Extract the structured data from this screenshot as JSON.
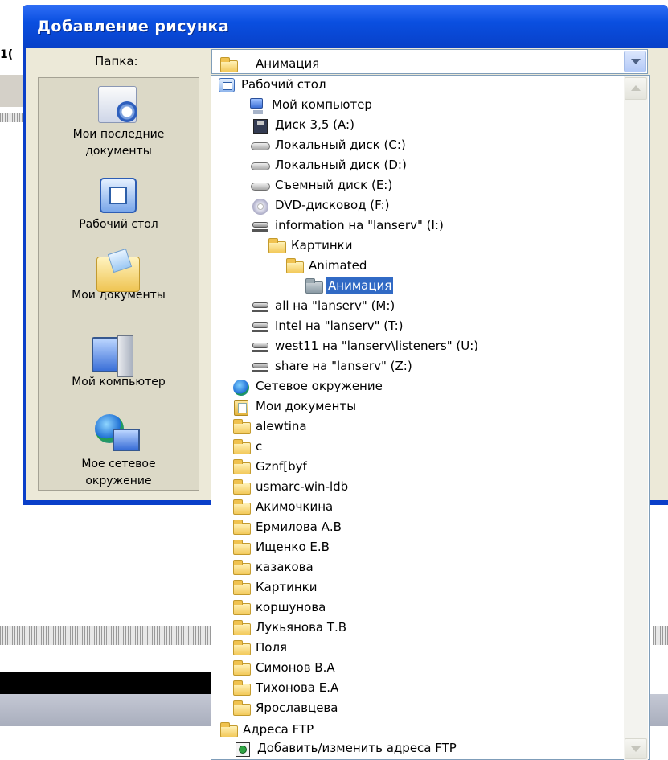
{
  "background": {
    "fragment_number": "1("
  },
  "dialog": {
    "title": "Добавление рисунка",
    "folder_label": "Папка:",
    "folder_value": "Анимация"
  },
  "places": [
    {
      "label": "Мои последние документы",
      "icon": "recent-documents-icon"
    },
    {
      "label": "Рабочий стол",
      "icon": "desktop-icon"
    },
    {
      "label": "Мои документы",
      "icon": "my-documents-icon"
    },
    {
      "label": "Мой компьютер",
      "icon": "my-computer-icon"
    },
    {
      "label": "Мое сетевое окружение",
      "icon": "network-places-icon"
    }
  ],
  "dropdown": {
    "selected": "Анимация",
    "items": [
      {
        "label": "Рабочий стол",
        "icon": "desktop-icon"
      },
      {
        "label": "Мой компьютер",
        "icon": "computer-icon"
      },
      {
        "label": "Диск 3,5 (A:)",
        "icon": "floppy-icon"
      },
      {
        "label": "Локальный диск (C:)",
        "icon": "hard-drive-icon"
      },
      {
        "label": "Локальный диск (D:)",
        "icon": "hard-drive-icon"
      },
      {
        "label": "Съемный диск (E:)",
        "icon": "removable-drive-icon"
      },
      {
        "label": "DVD-дисковод (F:)",
        "icon": "dvd-drive-icon"
      },
      {
        "label": "information на \"lanserv\" (I:)",
        "icon": "network-drive-icon"
      },
      {
        "label": "Картинки",
        "icon": "folder-icon"
      },
      {
        "label": "Animated",
        "icon": "folder-icon"
      },
      {
        "label": "Анимация",
        "icon": "folder-open-icon"
      },
      {
        "label": "all на \"lanserv\" (M:)",
        "icon": "network-drive-icon"
      },
      {
        "label": "Intel на \"lanserv\" (T:)",
        "icon": "network-drive-icon"
      },
      {
        "label": "west11 на \"lanserv\\listeners\" (U:)",
        "icon": "network-drive-icon"
      },
      {
        "label": "share на \"lanserv\" (Z:)",
        "icon": "network-drive-icon"
      },
      {
        "label": "Сетевое окружение",
        "icon": "network-places-icon"
      },
      {
        "label": "Мои документы",
        "icon": "my-documents-icon"
      },
      {
        "label": "alewtina",
        "icon": "folder-icon"
      },
      {
        "label": "c",
        "icon": "folder-icon"
      },
      {
        "label": "Gznf[byf",
        "icon": "folder-icon"
      },
      {
        "label": "usmarc-win-ldb",
        "icon": "folder-icon"
      },
      {
        "label": "Акимочкина",
        "icon": "folder-icon"
      },
      {
        "label": "Ермилова А.В",
        "icon": "folder-icon"
      },
      {
        "label": "Ищенко Е.В",
        "icon": "folder-icon"
      },
      {
        "label": "казакова",
        "icon": "folder-icon"
      },
      {
        "label": "Картинки",
        "icon": "folder-icon"
      },
      {
        "label": "коршунова",
        "icon": "folder-icon"
      },
      {
        "label": "Лукьянова Т.В",
        "icon": "folder-icon"
      },
      {
        "label": "Поля",
        "icon": "folder-icon"
      },
      {
        "label": "Симонов В.А",
        "icon": "folder-icon"
      },
      {
        "label": "Тихонова Е.А",
        "icon": "folder-icon"
      },
      {
        "label": "Ярославцева",
        "icon": "folder-icon"
      },
      {
        "label": "Адреса FTP",
        "icon": "folder-icon"
      },
      {
        "label": "Добавить/изменить адреса FTP",
        "icon": "ftp-add-icon"
      }
    ]
  },
  "colors": {
    "titlebar": "#0a4fe0",
    "selection": "#316ac5",
    "dialog_face": "#ece9d8"
  }
}
